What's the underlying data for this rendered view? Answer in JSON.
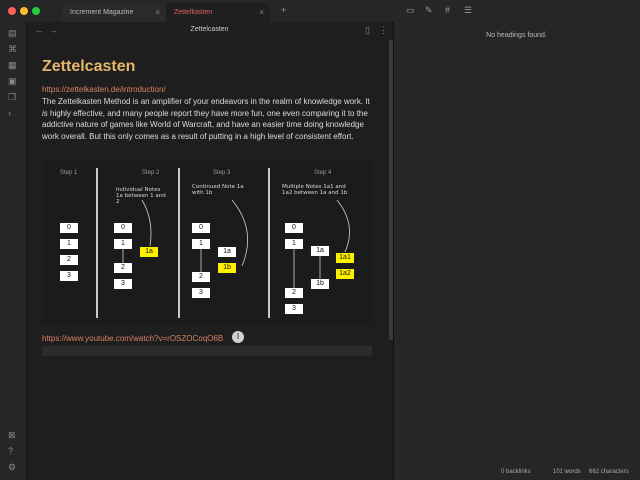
{
  "tabs": [
    {
      "label": "Increment Magazine",
      "active": false
    },
    {
      "label": "Zettelkasten",
      "active": true
    }
  ],
  "header": {
    "title": "Zettelcasten"
  },
  "note": {
    "heading": "Zettelcasten",
    "link1": "https://zettelkasten.de/introduction/",
    "para_a": "The Zettelkasten Method is an amplifier of your endeavors in the realm of knowledge work. It ",
    "para_is": "is",
    "para_b": " highly effective, and many people report they have more fun, one even comparing it to the addictive nature of games like World of Warcraft, and have an easier time doing knowledge work overall. But this only comes as a result of putting in a high level of consistent effort.",
    "link2": "https://www.youtube.com/watch?v=rOSZOCoqO6B",
    "cursor_glyph": "I"
  },
  "diagram": {
    "steps": [
      "Step 1",
      "Step 2",
      "Step 3",
      "Step 4"
    ],
    "annotations": [
      "Individual Notes 1a between 1 and 2",
      "Continued Note 1a with 1b",
      "Multiple Notes 1a1 and 1a2 between 1a and 1b"
    ],
    "boxes": {
      "step1": [
        "0",
        "1",
        "2",
        "3"
      ],
      "step2": [
        "0",
        "1",
        "1a",
        "2",
        "3"
      ],
      "step3": [
        "0",
        "1",
        "1a",
        "1b",
        "2",
        "3"
      ],
      "step4": [
        "0",
        "1",
        "1a",
        "1a1",
        "1a2",
        "1b",
        "2",
        "3"
      ]
    },
    "highlight_color": "#ffef00"
  },
  "outline": {
    "empty_text": "No headings found."
  },
  "status": {
    "backlinks": "0 backlinks",
    "words": "101 words",
    "chars": "662 characters"
  },
  "colors": {
    "heading": "#e4b66a",
    "link": "#d98265",
    "active_tab": "#e0605e",
    "background": "#1e1e1e"
  }
}
